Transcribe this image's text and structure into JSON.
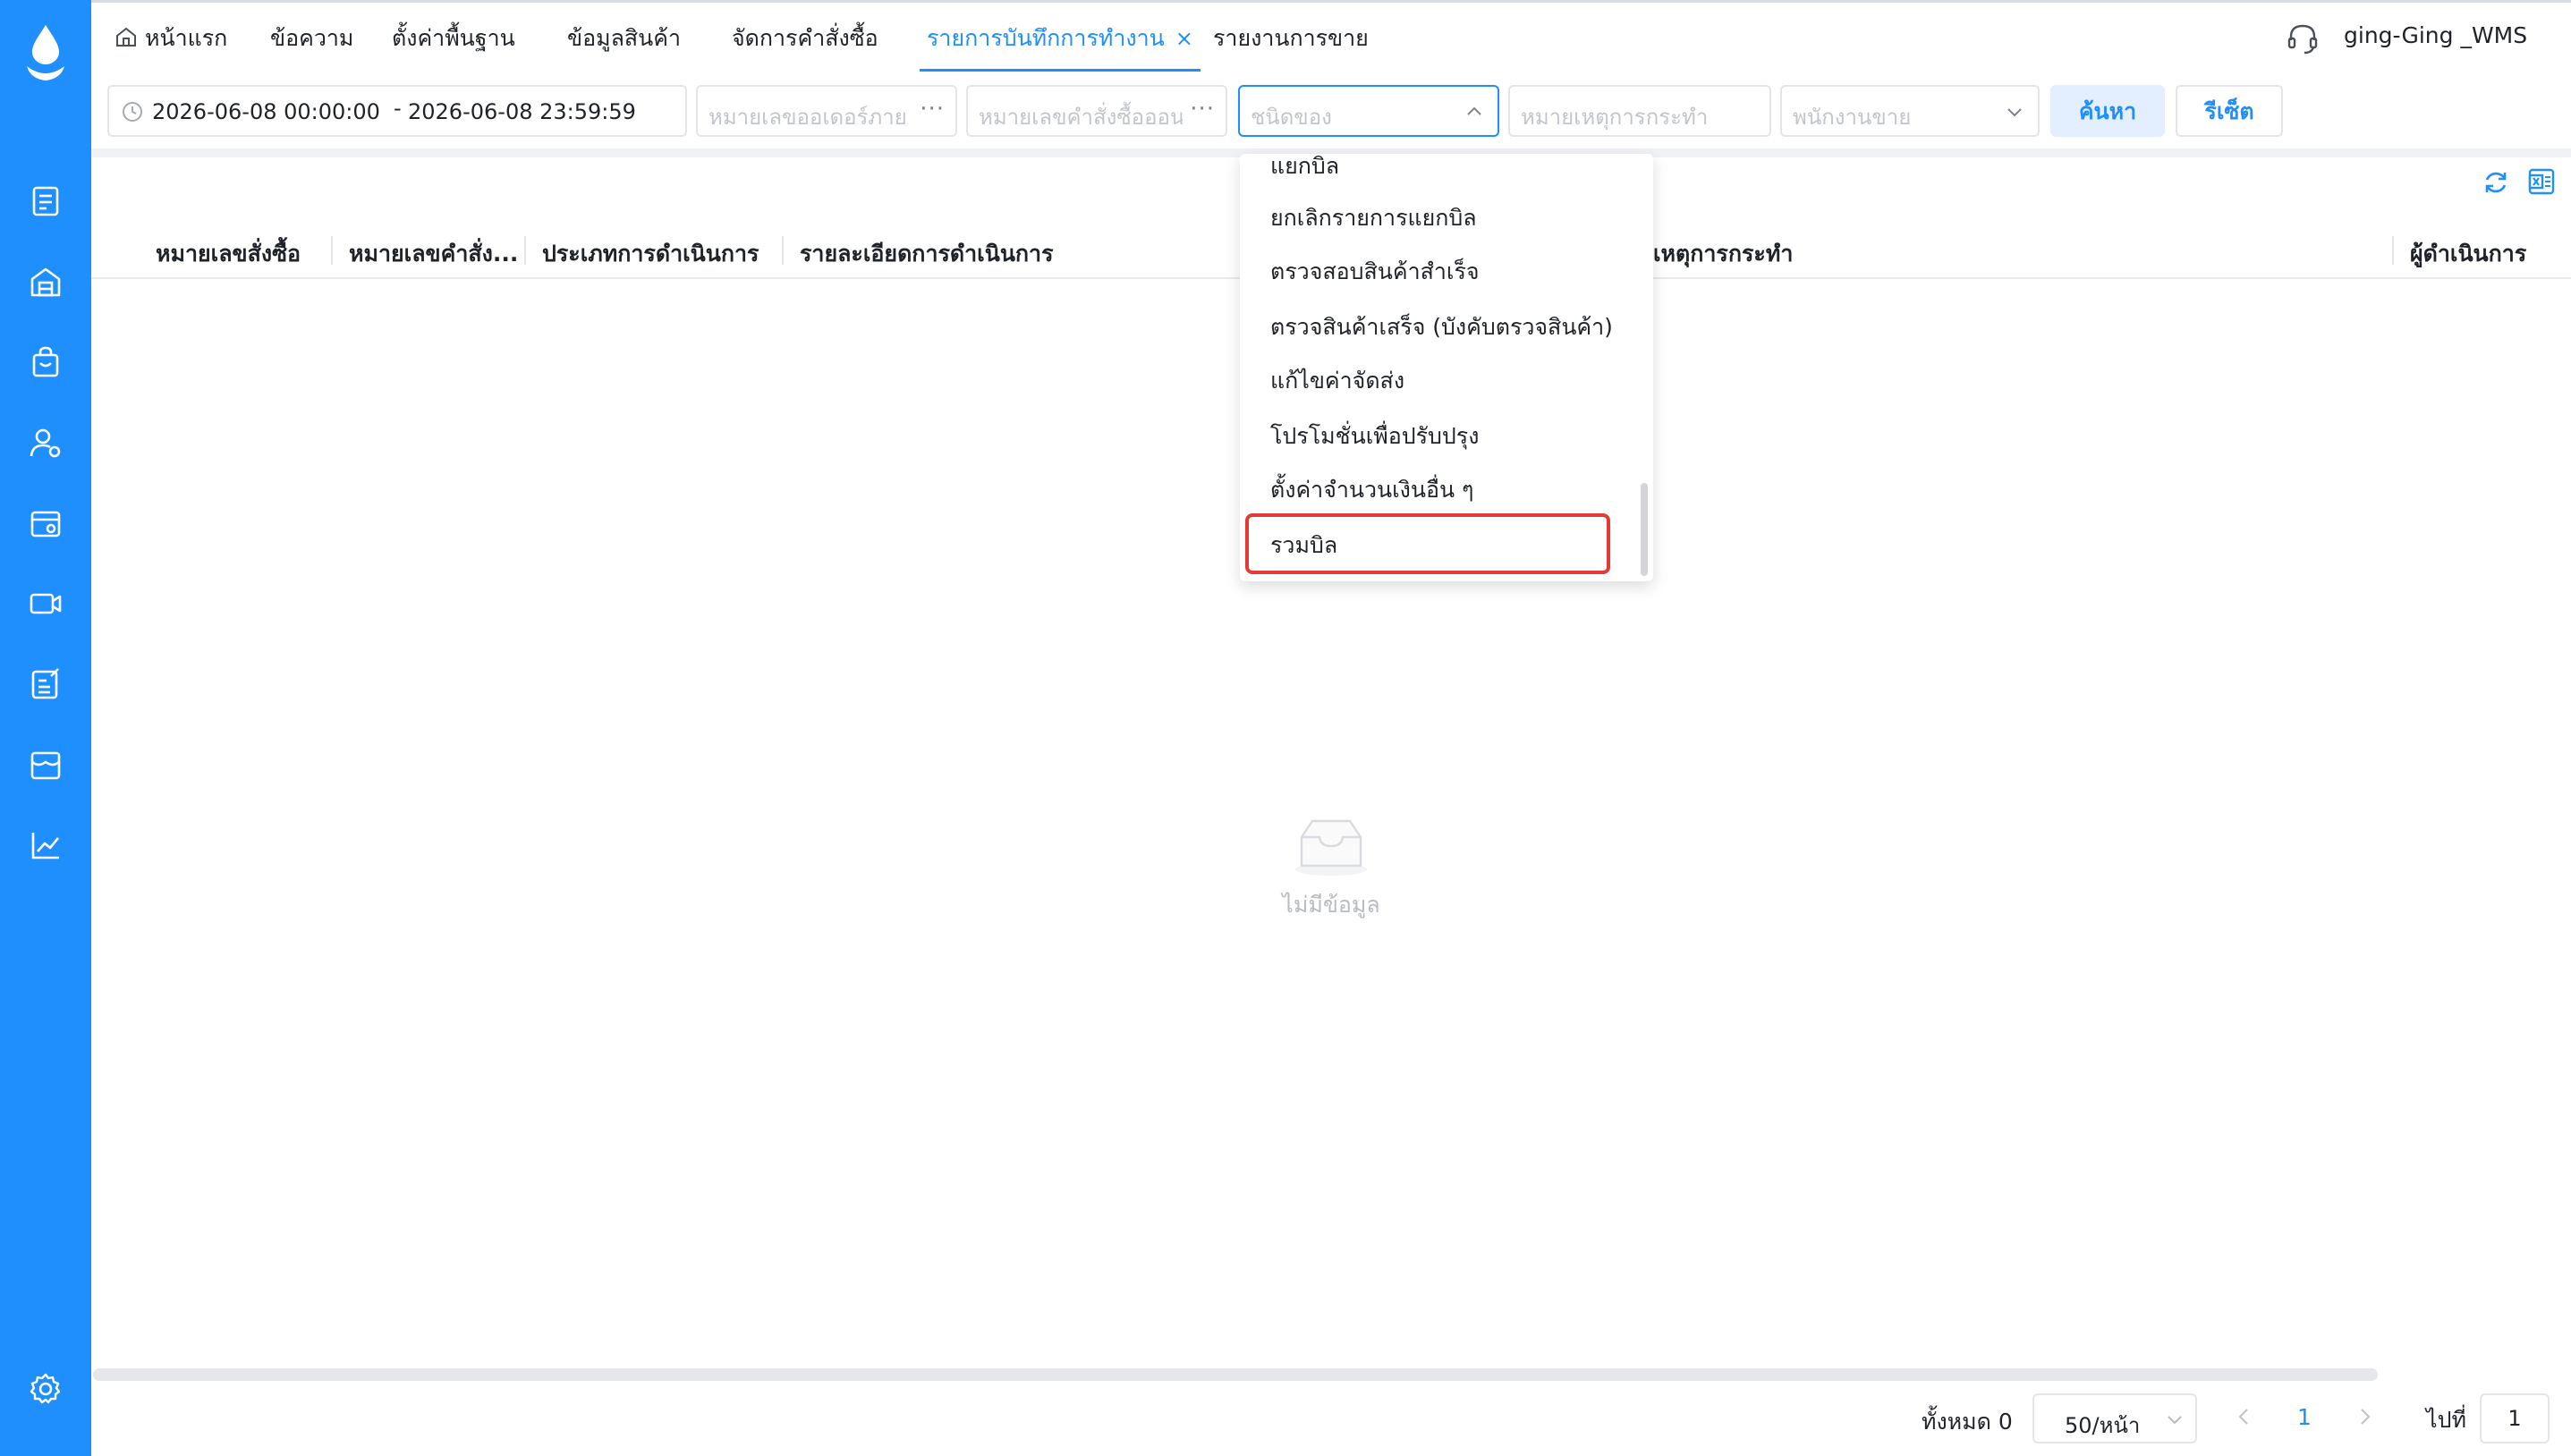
{
  "tabs": {
    "home": "หน้าแรก",
    "messages": "ข้อความ",
    "basic_settings": "ตั้งค่าพื้นฐาน",
    "product_info": "ข้อมูลสินค้า",
    "purchase_orders": "จัดการคำสั่งซื้อ",
    "operation_log": "รายการบันทึกการทำงาน",
    "close": "×",
    "sales_report": "รายงานการขาย"
  },
  "user": {
    "name": "ging-Ging _WMS"
  },
  "filters": {
    "date_start": "2026-06-08 00:00:00",
    "date_sep": "-",
    "date_end": "2026-06-08 23:59:59",
    "internal_order_placeholder": "หมายเลขออเดอร์ภาย",
    "online_order_placeholder": "หมายเลขคำสั่งซื้อออน",
    "type_placeholder": "ชนิดของ",
    "event_placeholder": "หมายเหตุการกระทำ",
    "salesperson_placeholder": "พนักงานขาย",
    "dots": "···",
    "search_label": "ค้นหา",
    "reset_label": "รีเซ็ต"
  },
  "table": {
    "headers": [
      "หมายเลขสั่งซื้อ",
      "หมายเลขคำสั่ง...",
      "ประเภทการดำเนินการ",
      "รายละเอียดการดำเนินการ",
      "เหตุการกระทำ",
      "ผู้ดำเนินการ"
    ],
    "empty_text": "ไม่มีข้อมูล"
  },
  "dropdown": {
    "items": [
      "แยกบิล",
      "ยกเลิกรายการแยกบิล",
      "ตรวจสอบสินค้าสำเร็จ",
      "ตรวจสินค้าเสร็จ (บังคับตรวจสินค้า)",
      "แก้ไขค่าจัดส่ง",
      "โปรโมชั่นเพื่อปรับปรุง",
      "ตั้งค่าจำนวนเงินอื่น ๆ",
      "รวมบิล"
    ]
  },
  "pagination": {
    "total": "ทั้งหมด 0",
    "page_size": "50/หน้า",
    "current_page": "1",
    "goto_label": "ไปที่",
    "goto_value": "1"
  },
  "colors": {
    "sidebar": "#1f8ffe",
    "accent": "#1f8ffe",
    "highlight": "#e53935"
  }
}
